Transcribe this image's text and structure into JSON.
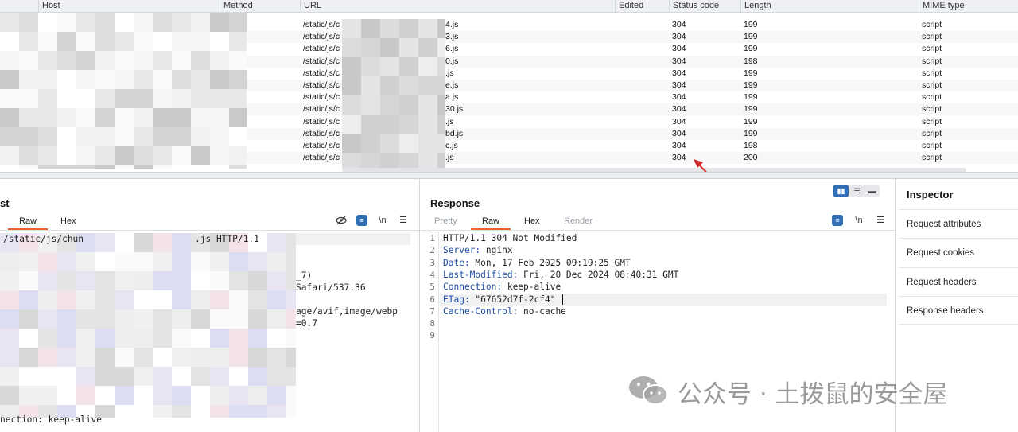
{
  "table": {
    "columns": [
      "Host",
      "Method",
      "URL",
      "Edited",
      "Status code",
      "Length",
      "MIME type"
    ],
    "rows": [
      {
        "url_start": "/static/js/c",
        "url_end": "4.js",
        "status": "304",
        "length": "199",
        "mime": "script"
      },
      {
        "url_start": "/static/js/c",
        "url_end": "3.js",
        "status": "304",
        "length": "199",
        "mime": "script"
      },
      {
        "url_start": "/static/js/c",
        "url_end": "6.js",
        "status": "304",
        "length": "199",
        "mime": "script"
      },
      {
        "url_start": "/static/js/c",
        "url_end": "0.js",
        "status": "304",
        "length": "198",
        "mime": "script"
      },
      {
        "url_start": "/static/js/c",
        "url_end": ".js",
        "status": "304",
        "length": "199",
        "mime": "script"
      },
      {
        "url_start": "/static/js/c",
        "url_end": "e.js",
        "status": "304",
        "length": "199",
        "mime": "script"
      },
      {
        "url_start": "/static/js/c",
        "url_end": "a.js",
        "status": "304",
        "length": "199",
        "mime": "script"
      },
      {
        "url_start": "/static/js/c",
        "url_end": "30.js",
        "status": "304",
        "length": "199",
        "mime": "script"
      },
      {
        "url_start": "/static/js/c",
        "url_end": ".js",
        "status": "304",
        "length": "199",
        "mime": "script"
      },
      {
        "url_start": "/static/js/c",
        "url_end": "bd.js",
        "status": "304",
        "length": "199",
        "mime": "script"
      },
      {
        "url_start": "/static/js/c",
        "url_end": "c.js",
        "status": "304",
        "length": "198",
        "mime": "script"
      },
      {
        "url_start": "/static/js/c",
        "url_end": ".js",
        "status": "304",
        "length": "200",
        "mime": "script"
      }
    ]
  },
  "request": {
    "title": "st",
    "tabs": [
      "Raw",
      "Hex"
    ],
    "active_tab": "Raw",
    "newline_icon": "\\n",
    "lines": {
      "l1a": "/static/js/chun",
      "l1b": ".js HTTP/1.1",
      "l4": "_7)",
      "l5": "Safari/537.36",
      "l7": "age/avif,image/webp",
      "l8": "=0.7",
      "last": "nection: keep-alive"
    }
  },
  "response": {
    "title": "Response",
    "tabs": [
      "Pretty",
      "Raw",
      "Hex",
      "Render"
    ],
    "active_tab": "Raw",
    "newline_icon": "\\n",
    "line_numbers": [
      "1",
      "2",
      "3",
      "4",
      "5",
      "6",
      "7",
      "8",
      "9"
    ],
    "lines": [
      {
        "key": "",
        "value": "HTTP/1.1 304 Not Modified"
      },
      {
        "key": "Server:",
        "value": " nginx"
      },
      {
        "key": "Date:",
        "value": " Mon, 17 Feb 2025 09:19:25 GMT"
      },
      {
        "key": "Last-Modified:",
        "value": " Fri, 20 Dec 2024 08:40:31 GMT"
      },
      {
        "key": "Connection:",
        "value": " keep-alive"
      },
      {
        "key": "ETag:",
        "value": " \"67652d7f-2cf4\""
      },
      {
        "key": "Cache-Control:",
        "value": " no-cache"
      },
      {
        "key": "",
        "value": ""
      },
      {
        "key": "",
        "value": ""
      }
    ]
  },
  "inspector": {
    "title": "Inspector",
    "sections": [
      "Request attributes",
      "Request cookies",
      "Request headers",
      "Response headers"
    ]
  },
  "watermark": {
    "text": "公众号 · 土拨鼠的安全屋"
  },
  "colors": {
    "accent": "#e8622a",
    "button_blue": "#2f6db5",
    "annotation_arrow": "#d22b2b"
  },
  "icons": [
    "hide-icon",
    "wrap-lines-icon",
    "newline-icon",
    "menu-icon",
    "layout-split-icon",
    "layout-rows-icon",
    "layout-tabs-icon",
    "wechat-icon"
  ]
}
